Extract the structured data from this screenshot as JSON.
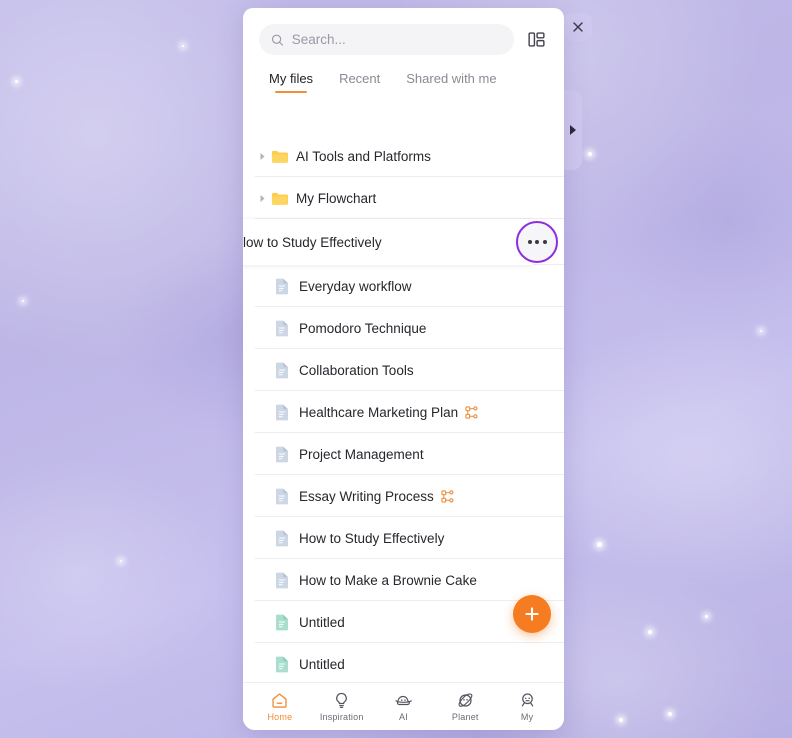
{
  "window": {
    "close_label": "×",
    "close_icon": "close-icon",
    "drawer_handle_icon": "chevron-right-icon"
  },
  "search": {
    "placeholder": "Search...",
    "value": "",
    "icon": "search-icon",
    "view_toggle_icon": "layout-grid-icon"
  },
  "tabs": [
    {
      "label": "My files",
      "active": true
    },
    {
      "label": "Recent",
      "active": false
    },
    {
      "label": "Shared with me",
      "active": false
    }
  ],
  "folders": [
    {
      "label": "AI Tools and Platforms",
      "caret_icon": "caret-right-icon",
      "icon": "folder-icon"
    },
    {
      "label": "My Flowchart",
      "caret_icon": "caret-right-icon",
      "icon": "folder-icon"
    }
  ],
  "dragged_row": {
    "label": "low to Study Effectively",
    "more_icon": "ellipsis-icon",
    "highlight_color": "#8f2ee0"
  },
  "files": [
    {
      "label": "Everyday workflow",
      "icon": "doc-blue-icon",
      "shared": false
    },
    {
      "label": "Pomodoro Technique",
      "icon": "doc-blue-icon",
      "shared": false
    },
    {
      "label": "Collaboration Tools",
      "icon": "doc-blue-icon",
      "shared": false
    },
    {
      "label": "Healthcare Marketing Plan",
      "icon": "doc-blue-icon",
      "shared": true
    },
    {
      "label": "Project Management",
      "icon": "doc-blue-icon",
      "shared": false
    },
    {
      "label": "Essay Writing Process",
      "icon": "doc-blue-icon",
      "shared": true
    },
    {
      "label": "How to Study Effectively",
      "icon": "doc-blue-icon",
      "shared": false
    },
    {
      "label": "How to Make a Brownie Cake",
      "icon": "doc-blue-icon",
      "shared": false
    },
    {
      "label": "Untitled",
      "icon": "doc-green-icon",
      "shared": false
    },
    {
      "label": "Untitled",
      "icon": "doc-green-icon",
      "shared": false
    }
  ],
  "fab": {
    "label": "+",
    "icon": "plus-icon",
    "color": "#f57c20"
  },
  "bottom_nav": [
    {
      "label": "Home",
      "icon": "home-icon",
      "active": true
    },
    {
      "label": "Inspiration",
      "icon": "lightbulb-icon",
      "active": false
    },
    {
      "label": "AI",
      "icon": "ai-planet-icon",
      "active": false
    },
    {
      "label": "Planet",
      "icon": "planet-icon",
      "active": false
    },
    {
      "label": "My",
      "icon": "user-icon",
      "active": false
    }
  ],
  "colors": {
    "accent": "#f09038",
    "highlight": "#8f2ee0",
    "folder": "#ffcc4d",
    "share": "#e8903a",
    "background": "#bdb6e6"
  }
}
